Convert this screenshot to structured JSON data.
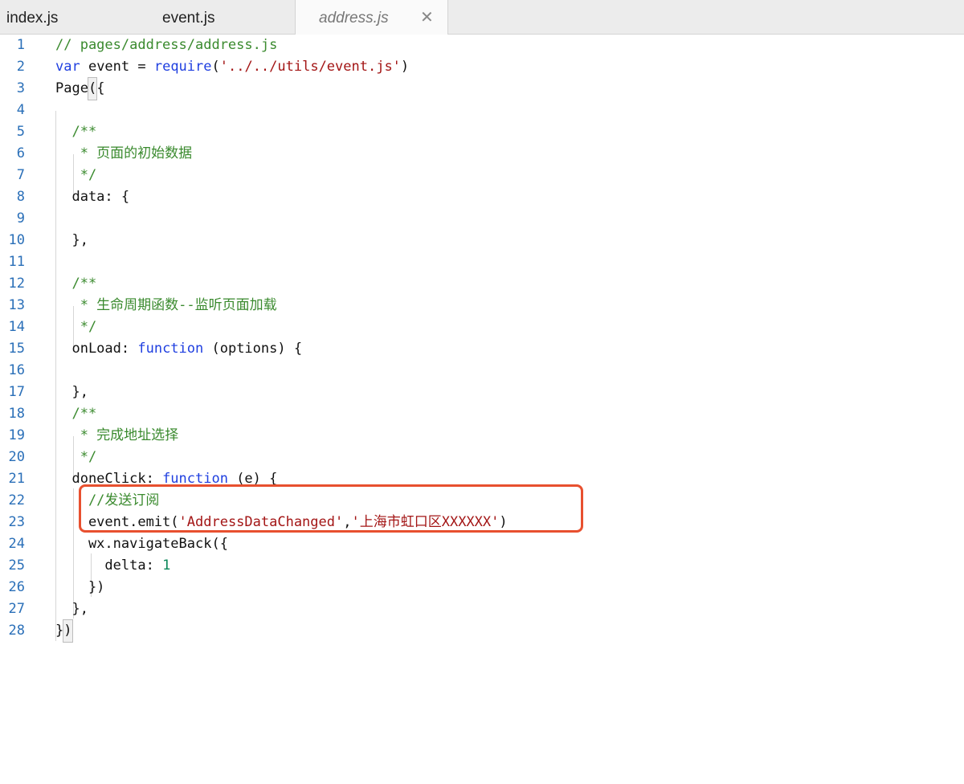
{
  "tabs": [
    {
      "label": "index.js",
      "active": false
    },
    {
      "label": "event.js",
      "active": false
    },
    {
      "label": "address.js",
      "active": true,
      "close_glyph": "✕"
    }
  ],
  "lines": [
    {
      "n": "1",
      "tokens": [
        {
          "t": "// pages/address/address.js",
          "c": "comment"
        }
      ]
    },
    {
      "n": "2",
      "tokens": [
        {
          "t": "var",
          "c": "keyword"
        },
        {
          "t": " event = ",
          "c": "plain"
        },
        {
          "t": "require",
          "c": "keyword"
        },
        {
          "t": "(",
          "c": "plain"
        },
        {
          "t": "'../../utils/event.js'",
          "c": "string"
        },
        {
          "t": ")",
          "c": "plain"
        }
      ]
    },
    {
      "n": "3",
      "tokens": [
        {
          "t": "Page",
          "c": "plain"
        },
        {
          "t": "(",
          "c": "bracket"
        },
        {
          "t": "{",
          "c": "plain"
        }
      ]
    },
    {
      "n": "4",
      "tokens": []
    },
    {
      "n": "5",
      "tokens": [
        {
          "t": "  /**",
          "c": "comment"
        }
      ]
    },
    {
      "n": "6",
      "tokens": [
        {
          "t": "   * 页面的初始数据",
          "c": "comment"
        }
      ]
    },
    {
      "n": "7",
      "tokens": [
        {
          "t": "   */",
          "c": "comment"
        }
      ]
    },
    {
      "n": "8",
      "tokens": [
        {
          "t": "  data: {",
          "c": "plain"
        }
      ]
    },
    {
      "n": "9",
      "tokens": []
    },
    {
      "n": "10",
      "tokens": [
        {
          "t": "  },",
          "c": "plain"
        }
      ]
    },
    {
      "n": "11",
      "tokens": []
    },
    {
      "n": "12",
      "tokens": [
        {
          "t": "  /**",
          "c": "comment"
        }
      ]
    },
    {
      "n": "13",
      "tokens": [
        {
          "t": "   * 生命周期函数--监听页面加载",
          "c": "comment"
        }
      ]
    },
    {
      "n": "14",
      "tokens": [
        {
          "t": "   */",
          "c": "comment"
        }
      ]
    },
    {
      "n": "15",
      "tokens": [
        {
          "t": "  onLoad: ",
          "c": "plain"
        },
        {
          "t": "function",
          "c": "keyword"
        },
        {
          "t": " (options) {",
          "c": "plain"
        }
      ]
    },
    {
      "n": "16",
      "tokens": []
    },
    {
      "n": "17",
      "tokens": [
        {
          "t": "  },",
          "c": "plain"
        }
      ]
    },
    {
      "n": "18",
      "tokens": [
        {
          "t": "  /**",
          "c": "comment"
        }
      ]
    },
    {
      "n": "19",
      "tokens": [
        {
          "t": "   * 完成地址选择",
          "c": "comment"
        }
      ]
    },
    {
      "n": "20",
      "tokens": [
        {
          "t": "   */",
          "c": "comment"
        }
      ]
    },
    {
      "n": "21",
      "tokens": [
        {
          "t": "  doneClick: ",
          "c": "plain"
        },
        {
          "t": "function",
          "c": "keyword"
        },
        {
          "t": " (e) {",
          "c": "plain"
        }
      ]
    },
    {
      "n": "22",
      "tokens": [
        {
          "t": "    //发送订阅",
          "c": "comment"
        }
      ]
    },
    {
      "n": "23",
      "tokens": [
        {
          "t": "    event.emit(",
          "c": "plain"
        },
        {
          "t": "'AddressDataChanged'",
          "c": "string"
        },
        {
          "t": ",",
          "c": "plain"
        },
        {
          "t": "'上海市虹口区XXXXXX'",
          "c": "string"
        },
        {
          "t": ")",
          "c": "plain"
        }
      ]
    },
    {
      "n": "24",
      "tokens": [
        {
          "t": "    wx.navigateBack({",
          "c": "plain"
        }
      ]
    },
    {
      "n": "25",
      "tokens": [
        {
          "t": "      delta: ",
          "c": "plain"
        },
        {
          "t": "1",
          "c": "number"
        }
      ]
    },
    {
      "n": "26",
      "tokens": [
        {
          "t": "    })",
          "c": "plain"
        }
      ]
    },
    {
      "n": "27",
      "tokens": [
        {
          "t": "  },",
          "c": "plain"
        }
      ]
    },
    {
      "n": "28",
      "tokens": [
        {
          "t": "}",
          "c": "plain"
        },
        {
          "t": ")",
          "c": "bracket"
        }
      ]
    }
  ],
  "colors": {
    "comment": "#3a8a2e",
    "keyword": "#1f3fe0",
    "string": "#a31515",
    "number": "#098658",
    "line_number": "#2a6fb8",
    "highlight_border": "#e8502f"
  }
}
